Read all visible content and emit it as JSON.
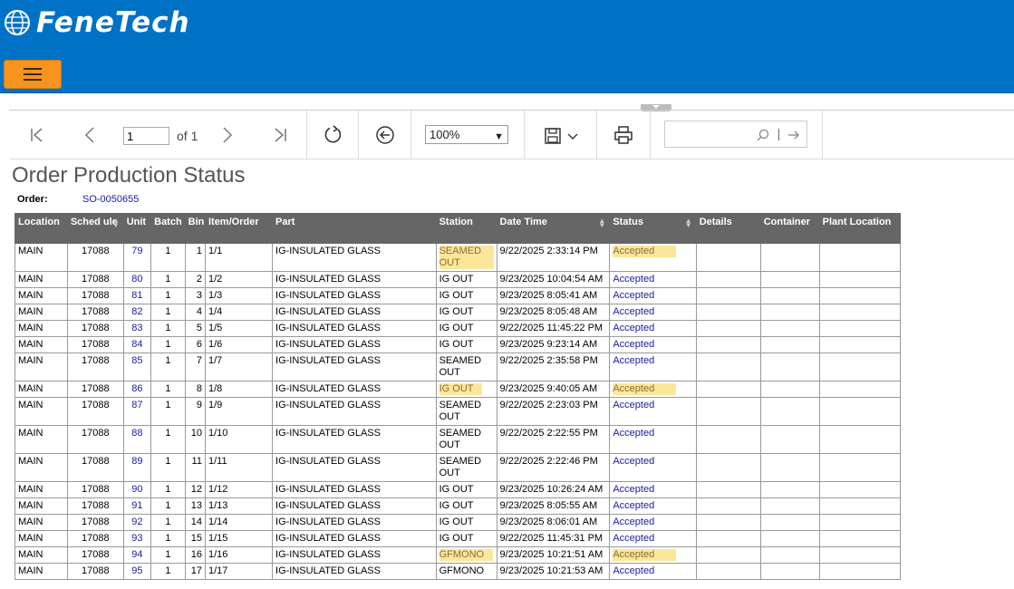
{
  "app": {
    "logo_text": "FeneTech"
  },
  "toolbar": {
    "page_value": "1",
    "page_of": "of 1",
    "zoom": "100%"
  },
  "report": {
    "title": "Order Production Status",
    "order_label": "Order:",
    "order_value": "SO-0050655"
  },
  "table": {
    "headers": [
      "Location",
      "Sched ule",
      "Unit",
      "Batch",
      "Bin",
      "Item/Order",
      "Part",
      "Station",
      "Date Time",
      "Status",
      "Details",
      "Container",
      "Plant Location"
    ],
    "rows": [
      {
        "loc": "MAIN",
        "sched": "17088",
        "unit": "79",
        "batch": "1",
        "bin": "1",
        "item": "1/1",
        "part": "IG-INSULATED GLASS",
        "station": "SEAMED OUT",
        "dt": "9/22/2025 2:33:14 PM",
        "status": "Accepted",
        "hl": true
      },
      {
        "loc": "MAIN",
        "sched": "17088",
        "unit": "80",
        "batch": "1",
        "bin": "2",
        "item": "1/2",
        "part": "IG-INSULATED GLASS",
        "station": "IG OUT",
        "dt": "9/23/2025 10:04:54 AM",
        "status": "Accepted",
        "hl": false
      },
      {
        "loc": "MAIN",
        "sched": "17088",
        "unit": "81",
        "batch": "1",
        "bin": "3",
        "item": "1/3",
        "part": "IG-INSULATED GLASS",
        "station": "IG OUT",
        "dt": "9/23/2025 8:05:41 AM",
        "status": "Accepted",
        "hl": false
      },
      {
        "loc": "MAIN",
        "sched": "17088",
        "unit": "82",
        "batch": "1",
        "bin": "4",
        "item": "1/4",
        "part": "IG-INSULATED GLASS",
        "station": "IG OUT",
        "dt": "9/23/2025 8:05:48 AM",
        "status": "Accepted",
        "hl": false
      },
      {
        "loc": "MAIN",
        "sched": "17088",
        "unit": "83",
        "batch": "1",
        "bin": "5",
        "item": "1/5",
        "part": "IG-INSULATED GLASS",
        "station": "IG OUT",
        "dt": "9/22/2025 11:45:22 PM",
        "status": "Accepted",
        "hl": false
      },
      {
        "loc": "MAIN",
        "sched": "17088",
        "unit": "84",
        "batch": "1",
        "bin": "6",
        "item": "1/6",
        "part": "IG-INSULATED GLASS",
        "station": "IG OUT",
        "dt": "9/23/2025 9:23:14 AM",
        "status": "Accepted",
        "hl": false
      },
      {
        "loc": "MAIN",
        "sched": "17088",
        "unit": "85",
        "batch": "1",
        "bin": "7",
        "item": "1/7",
        "part": "IG-INSULATED GLASS",
        "station": "SEAMED OUT",
        "dt": "9/22/2025 2:35:58 PM",
        "status": "Accepted",
        "hl": false
      },
      {
        "loc": "MAIN",
        "sched": "17088",
        "unit": "86",
        "batch": "1",
        "bin": "8",
        "item": "1/8",
        "part": "IG-INSULATED GLASS",
        "station": "IG OUT",
        "dt": "9/23/2025 9:40:05 AM",
        "status": "Accepted",
        "hl": true
      },
      {
        "loc": "MAIN",
        "sched": "17088",
        "unit": "87",
        "batch": "1",
        "bin": "9",
        "item": "1/9",
        "part": "IG-INSULATED GLASS",
        "station": "SEAMED OUT",
        "dt": "9/22/2025 2:23:03 PM",
        "status": "Accepted",
        "hl": false
      },
      {
        "loc": "MAIN",
        "sched": "17088",
        "unit": "88",
        "batch": "1",
        "bin": "10",
        "item": "1/10",
        "part": "IG-INSULATED GLASS",
        "station": "SEAMED OUT",
        "dt": "9/22/2025 2:22:55 PM",
        "status": "Accepted",
        "hl": false
      },
      {
        "loc": "MAIN",
        "sched": "17088",
        "unit": "89",
        "batch": "1",
        "bin": "11",
        "item": "1/11",
        "part": "IG-INSULATED GLASS",
        "station": "SEAMED OUT",
        "dt": "9/22/2025 2:22:46 PM",
        "status": "Accepted",
        "hl": false
      },
      {
        "loc": "MAIN",
        "sched": "17088",
        "unit": "90",
        "batch": "1",
        "bin": "12",
        "item": "1/12",
        "part": "IG-INSULATED GLASS",
        "station": "IG OUT",
        "dt": "9/23/2025 10:26:24 AM",
        "status": "Accepted",
        "hl": false
      },
      {
        "loc": "MAIN",
        "sched": "17088",
        "unit": "91",
        "batch": "1",
        "bin": "13",
        "item": "1/13",
        "part": "IG-INSULATED GLASS",
        "station": "IG OUT",
        "dt": "9/23/2025 8:05:55 AM",
        "status": "Accepted",
        "hl": false
      },
      {
        "loc": "MAIN",
        "sched": "17088",
        "unit": "92",
        "batch": "1",
        "bin": "14",
        "item": "1/14",
        "part": "IG-INSULATED GLASS",
        "station": "IG OUT",
        "dt": "9/23/2025 8:06:01 AM",
        "status": "Accepted",
        "hl": false
      },
      {
        "loc": "MAIN",
        "sched": "17088",
        "unit": "93",
        "batch": "1",
        "bin": "15",
        "item": "1/15",
        "part": "IG-INSULATED GLASS",
        "station": "IG OUT",
        "dt": "9/22/2025 11:45:31 PM",
        "status": "Accepted",
        "hl": false
      },
      {
        "loc": "MAIN",
        "sched": "17088",
        "unit": "94",
        "batch": "1",
        "bin": "16",
        "item": "1/16",
        "part": "IG-INSULATED GLASS",
        "station": "GFMONO",
        "dt": "9/23/2025 10:21:51 AM",
        "status": "Accepted",
        "hl": true
      },
      {
        "loc": "MAIN",
        "sched": "17088",
        "unit": "95",
        "batch": "1",
        "bin": "17",
        "item": "1/17",
        "part": "IG-INSULATED GLASS",
        "station": "GFMONO",
        "dt": "9/23/2025 10:21:53 AM",
        "status": "Accepted",
        "hl": false
      }
    ]
  },
  "colors": {
    "header_blue": "#0072c6",
    "menu_orange": "#f7941d",
    "highlight": "#fbe79a",
    "link": "#1a1aa6",
    "table_header": "#666666"
  }
}
